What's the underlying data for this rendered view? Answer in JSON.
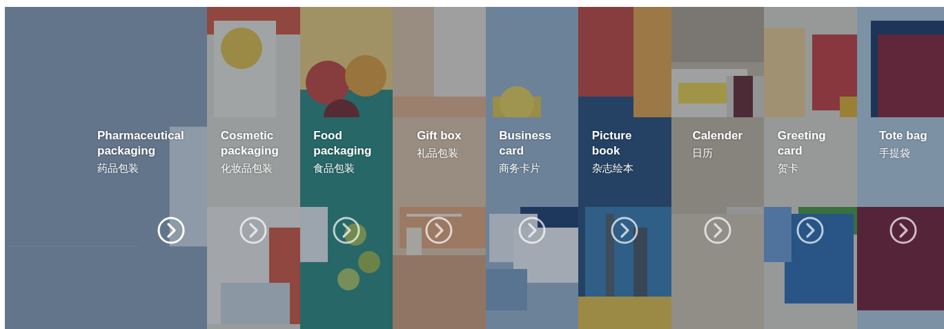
{
  "panels": [
    {
      "title": "Pharmaceutical packaging",
      "subtitle": "药品包装",
      "expanded": true
    },
    {
      "title": "Cosmetic packaging",
      "subtitle": "化妆品包装",
      "expanded": false
    },
    {
      "title": "Food packaging",
      "subtitle": "食品包装",
      "expanded": false
    },
    {
      "title": "Gift box",
      "subtitle": "礼品包装",
      "expanded": false
    },
    {
      "title": "Business card",
      "subtitle": "商务卡片",
      "expanded": false
    },
    {
      "title": "Picture book",
      "subtitle": "杂志绘本",
      "expanded": false
    },
    {
      "title": "Calender",
      "subtitle": "日历",
      "expanded": false
    },
    {
      "title": "Greeting card",
      "subtitle": "贺卡",
      "expanded": false
    },
    {
      "title": "Tote bag",
      "subtitle": "手提袋",
      "expanded": false
    }
  ]
}
